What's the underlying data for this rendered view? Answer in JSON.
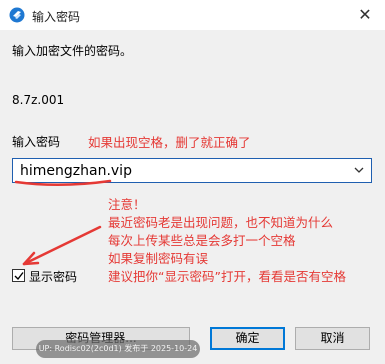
{
  "window": {
    "title": "输入密码",
    "close_glyph": "✕"
  },
  "dialog": {
    "prompt": "输入加密文件的密码。",
    "filename": "8.7z.001",
    "password_label": "输入密码",
    "password_value": "himengzhan.vip",
    "show_password_label": "显示密码",
    "show_password_checked": true
  },
  "buttons": {
    "manager": "密码管理器...",
    "ok": "确定",
    "cancel": "取消"
  },
  "annotations": {
    "color": "#e53935",
    "note_top": "如果出现空格，删了就正确了",
    "notes": [
      "注意！",
      "最近密码老是出现问题，也不知道为什么",
      "每次上传某些总是会多打一个空格",
      "如果复制密码有误",
      "建议把你“显示密码”打开，看看是否有空格"
    ]
  },
  "watermark": {
    "text": "UP: Rodisc02(2c0d1) 发布于 2025-10-24"
  },
  "icons": {
    "app": "app-icon",
    "close": "close-icon",
    "dropdown": "chevron-down-icon",
    "check": "check-icon"
  }
}
